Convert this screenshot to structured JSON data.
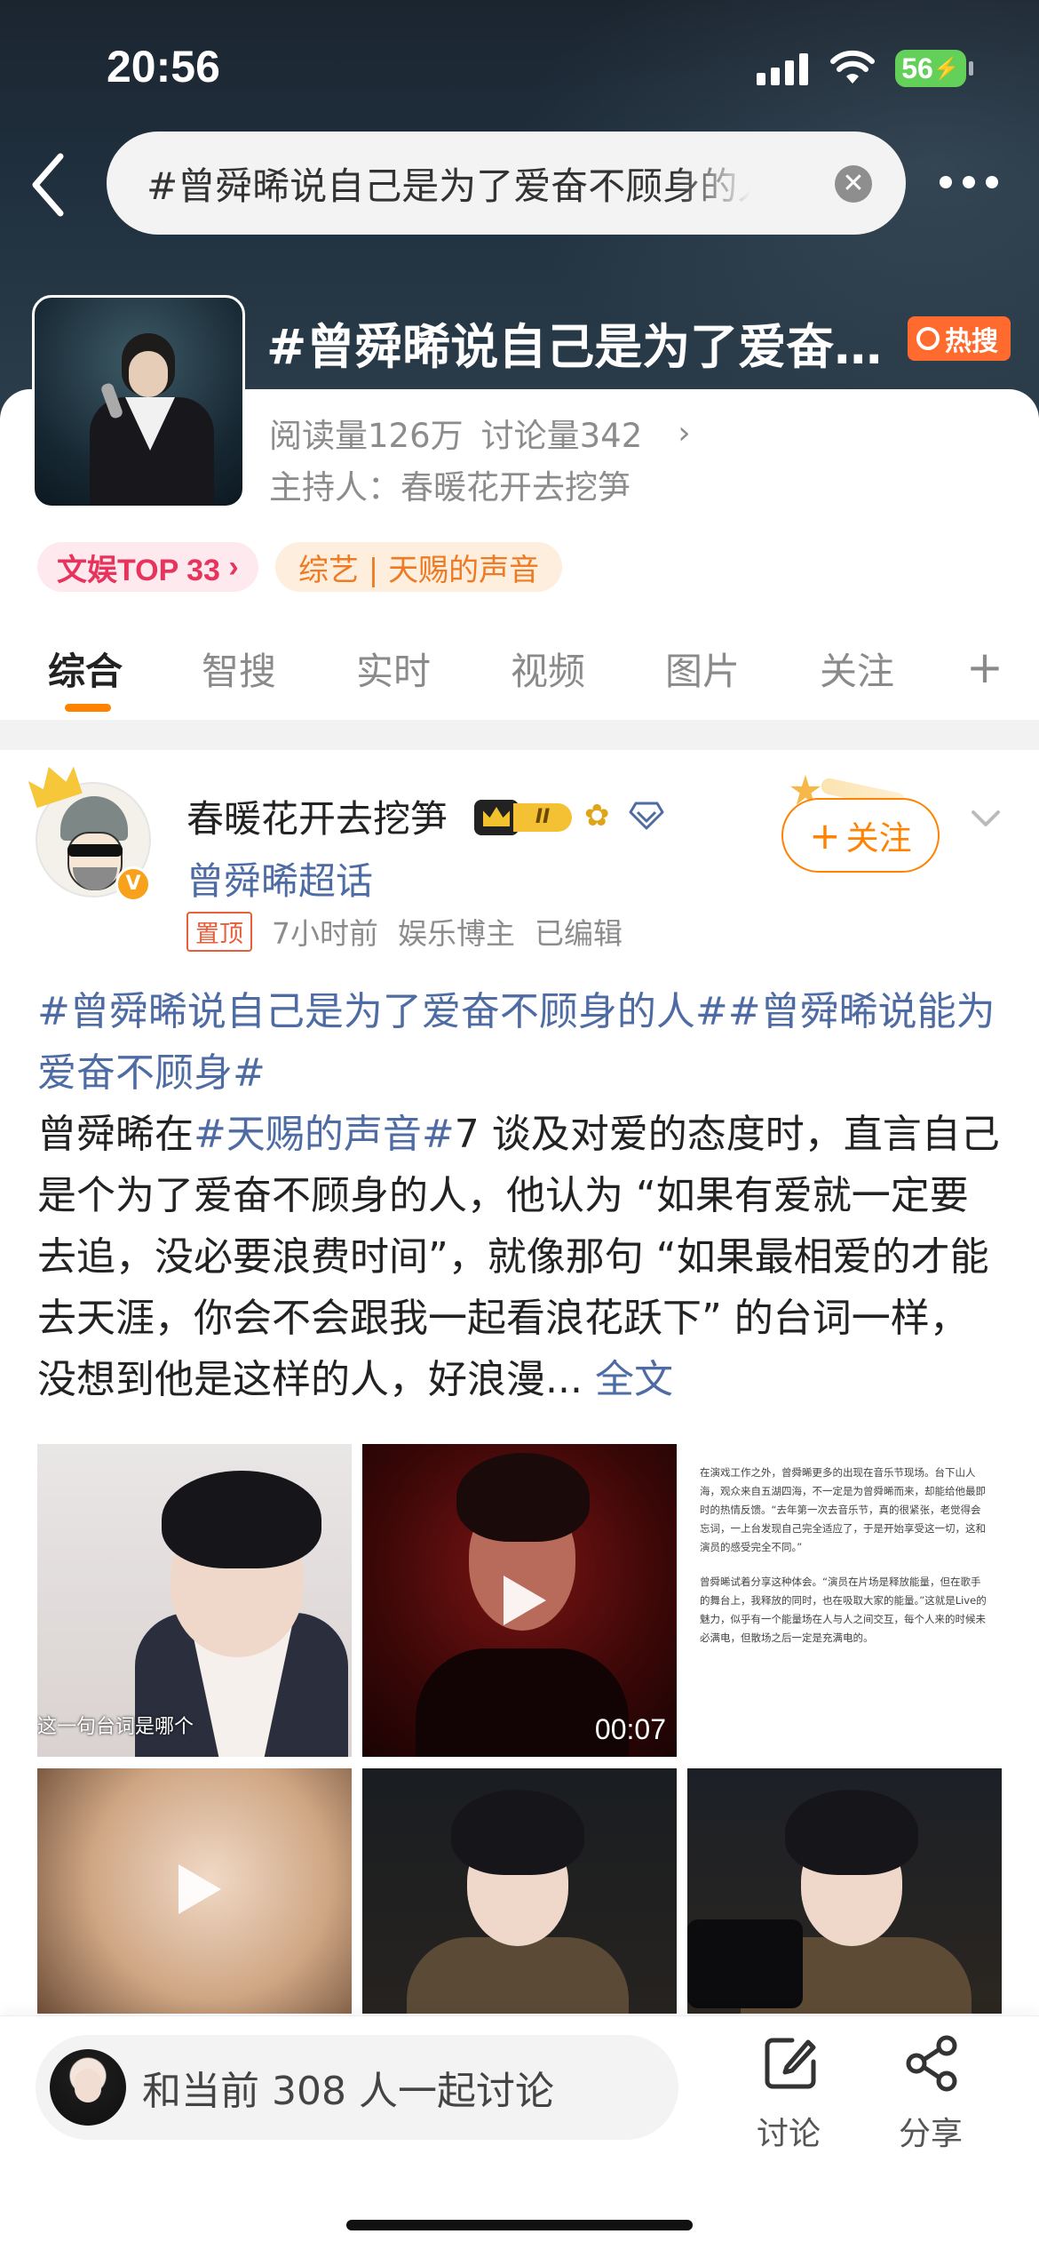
{
  "status_bar": {
    "time": "20:56",
    "battery": "56"
  },
  "search": {
    "query": "#曾舜晞说自己是为了爱奋不顾身的人#"
  },
  "topic": {
    "title": "#曾舜晞说自己是为了爱奋不顾身的人#",
    "hot_badge": "热搜",
    "reads": "阅读量126万",
    "discussions": "讨论量342",
    "host": "主持人：春暖花开去挖笋",
    "rank_tag": "文娱TOP 33",
    "category_tag": "综艺 | 天赐的声音"
  },
  "tabs": [
    "综合",
    "智搜",
    "实时",
    "视频",
    "图片",
    "关注"
  ],
  "post": {
    "author": "春暖花开去挖笋",
    "level": "II",
    "supertopic": "曾舜晞超话",
    "pinned": "置顶",
    "time": "7小时前",
    "role": "娱乐博主",
    "edited": "已编辑",
    "follow_label": "关注",
    "hashtag1": "#曾舜晞说自己是为了爱奋不顾身的人#",
    "hashtag2": "#曾舜晞说能为爱奋不顾身#",
    "text_intro": "曾舜晞在",
    "hashtag3": "#天赐的声音#",
    "text_body": "7 谈及对爱的态度时，直言自己是个为了爱奋不顾身的人，他认为 “如果有爱就一定要去追，没必要浪费时间”，就像那句 “如果最相爱的才能去天涯，你会不会跟我一起看浪花跃下” 的台词一样，没想到他是这样的人，好浪漫...",
    "more": "全文",
    "media": {
      "img1_subtitle": "这一句台词是哪个",
      "video1_duration": "00:07",
      "article_p1": "在演戏工作之外，曾舜晞更多的出现在音乐节现场。台下山人海，观众来自五湖四海，不一定是为曾舜晞而来，却能给他最即时的热情反馈。“去年第一次去音乐节，真的很紧张，老觉得会忘词，一上台发现自己完全适应了，于是开始享受这一切，这和演员的感受完全不同。”",
      "article_p2": "曾舜晞试着分享这种体会。“演员在片场是释放能量，但在歌手的舞台上，我释放的同时，也在吸取大家的能量。”这就是Live的魅力，似乎有一个能量场在人与人之间交互，每个人来的时候未必满电，但散场之后一定是充满电的。"
    }
  },
  "bottom_bar": {
    "discuss_prompt": "和当前 308 人一起讨论",
    "discuss_label": "讨论",
    "share_label": "分享"
  }
}
